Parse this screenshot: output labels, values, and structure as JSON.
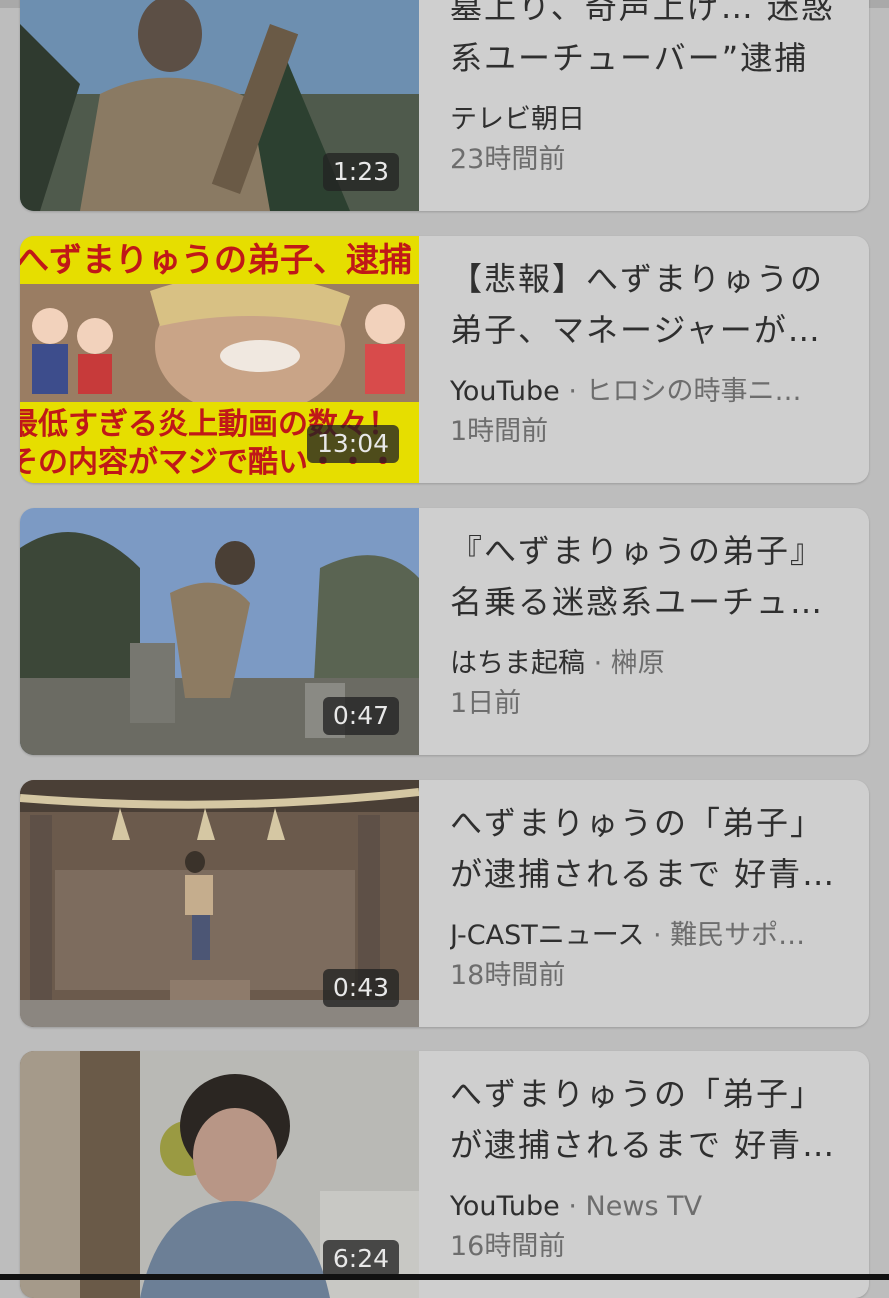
{
  "videos": [
    {
      "title": "墓上り、奇声上げ… 迷惑\n系ユーチューバー”逮捕",
      "channel": "テレビ朝日",
      "extra": "",
      "time": "23時間前",
      "duration": "1:23"
    },
    {
      "title": "【悲報】へずまりゅうの\n弟子、マネージャーが…",
      "channel": "YouTube",
      "extra": "· ヒロシの時事ニ…",
      "time": "1時間前",
      "duration": "13:04",
      "overlay_top": "へずまりゅうの弟子、逮捕",
      "overlay_bottom1": "最低すぎる炎上動画の数々！",
      "overlay_bottom2": "その内容がマジで酷い・・・"
    },
    {
      "title": "『へずまりゅうの弟子』\n名乗る迷惑系ユーチュ…",
      "channel": "はちま起稿",
      "extra": "· 榊原",
      "time": "1日前",
      "duration": "0:47"
    },
    {
      "title": "へずまりゅうの「弟子」\nが逮捕されるまで 好青…",
      "channel": "J-CASTニュース",
      "extra": "· 難民サポ…",
      "time": "18時間前",
      "duration": "0:43"
    },
    {
      "title": "へずまりゅうの「弟子」\nが逮捕されるまで 好青…",
      "channel": "YouTube",
      "extra": "· News TV",
      "time": "16時間前",
      "duration": "6:24"
    }
  ]
}
